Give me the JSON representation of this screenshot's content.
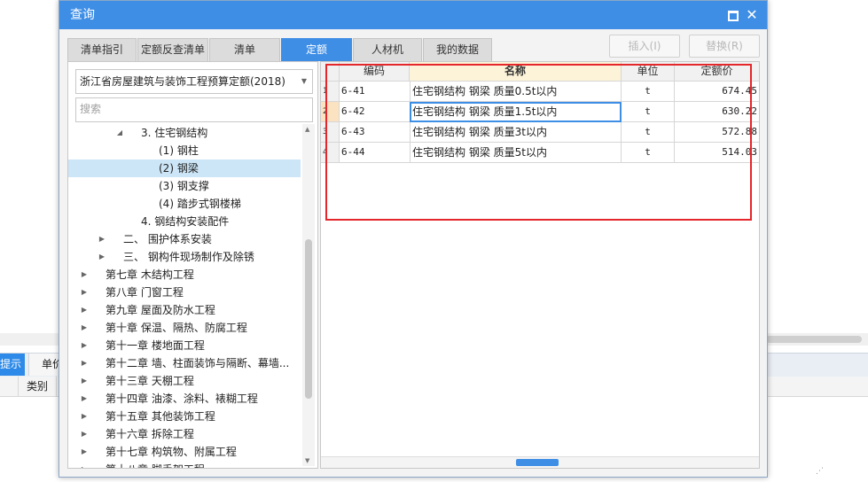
{
  "dialog": {
    "title": "查询",
    "tabs": [
      "清单指引",
      "定额反查清单",
      "清单",
      "定额",
      "人材机",
      "我的数据"
    ],
    "active_tab": "定额",
    "insert_label": "插入(I)",
    "replace_label": "替换(R)"
  },
  "left": {
    "library": "浙江省房屋建筑与装饰工程预算定额(2018)",
    "search_placeholder": "搜索",
    "tree": [
      {
        "label": "3. 住宅钢结构",
        "expand": "down"
      },
      {
        "label": "(1) 钢柱",
        "expand": ""
      },
      {
        "label": "(2) 钢梁",
        "expand": "",
        "selected": true
      },
      {
        "label": "(3) 钢支撑",
        "expand": ""
      },
      {
        "label": "(4) 踏步式钢楼梯",
        "expand": ""
      },
      {
        "label": "4. 钢结构安装配件",
        "expand": ""
      },
      {
        "label": "二、 围护体系安装",
        "expand": "right"
      },
      {
        "label": "三、 钢构件现场制作及除锈",
        "expand": "right"
      },
      {
        "label": "第七章 木结构工程",
        "expand": "right"
      },
      {
        "label": "第八章 门窗工程",
        "expand": "right"
      },
      {
        "label": "第九章 屋面及防水工程",
        "expand": "right"
      },
      {
        "label": "第十章 保温、隔热、防腐工程",
        "expand": "right"
      },
      {
        "label": "第十一章 楼地面工程",
        "expand": "right"
      },
      {
        "label": "第十二章 墙、柱面装饰与隔断、幕墙...",
        "expand": "right"
      },
      {
        "label": "第十三章 天棚工程",
        "expand": "right"
      },
      {
        "label": "第十四章 油漆、涂料、裱糊工程",
        "expand": "right"
      },
      {
        "label": "第十五章 其他装饰工程",
        "expand": "right"
      },
      {
        "label": "第十六章 拆除工程",
        "expand": "right"
      },
      {
        "label": "第十七章 构筑物、附属工程",
        "expand": "right"
      },
      {
        "label": "第十八章 脚手架工程",
        "expand": "right"
      }
    ]
  },
  "grid": {
    "headers": {
      "code": "编码",
      "name": "名称",
      "unit": "单位",
      "price": "定额价"
    },
    "rows": [
      {
        "n": "1",
        "code": "6-41",
        "name": "住宅钢结构 钢梁 质量0.5t以内",
        "unit": "t",
        "price": "674.45"
      },
      {
        "n": "2",
        "code": "6-42",
        "name": "住宅钢结构 钢梁 质量1.5t以内",
        "unit": "t",
        "price": "630.22",
        "selected": true
      },
      {
        "n": "3",
        "code": "6-43",
        "name": "住宅钢结构 钢梁 质量3t以内",
        "unit": "t",
        "price": "572.88"
      },
      {
        "n": "4",
        "code": "6-44",
        "name": "住宅钢结构 钢梁 质量5t以内",
        "unit": "t",
        "price": "514.03"
      }
    ]
  },
  "background": {
    "tab_active": "提示",
    "tab_other": "单价",
    "col_type": "类别"
  }
}
